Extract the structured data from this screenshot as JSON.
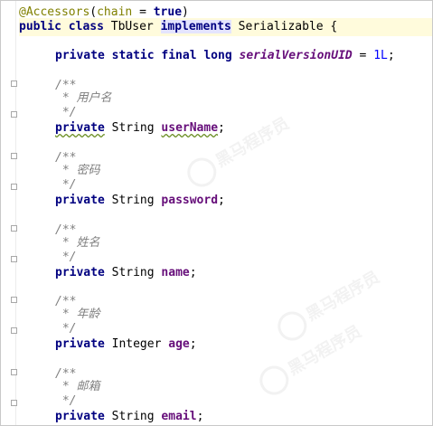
{
  "annotation": {
    "at": "@",
    "name": "Accessors",
    "open": "(",
    "param": "chain",
    "eq": " = ",
    "value": "true",
    "close": ")"
  },
  "class_decl": {
    "kw_public": "public",
    "kw_class": "class",
    "name": "TbUser",
    "kw_implements": "implements",
    "interface": "Serializable",
    "brace": "{"
  },
  "serial": {
    "modifiers": "private static final long",
    "name": "serialVersionUID",
    "eq": " = ",
    "value": "1L",
    "semi": ";"
  },
  "comment": {
    "open": "/**",
    "close": " */"
  },
  "fields": [
    {
      "comment": " * 用户名",
      "modifier": "private",
      "type": "String",
      "name": "userName",
      "semi": ";"
    },
    {
      "comment": " * 密码",
      "modifier": "private",
      "type": "String",
      "name": "password",
      "semi": ";"
    },
    {
      "comment": " * 姓名",
      "modifier": "private",
      "type": "String",
      "name": "name",
      "semi": ";"
    },
    {
      "comment": " * 年龄",
      "modifier": "private",
      "type": "Integer",
      "name": "age",
      "semi": ";"
    },
    {
      "comment": " * 邮箱",
      "modifier": "private",
      "type": "String",
      "name": "email",
      "semi": ";"
    }
  ],
  "watermark": {
    "text": "黑马程序员"
  },
  "colors": {
    "keyword": "#000080",
    "annotation": "#808000",
    "field": "#660e7a",
    "number": "#0000ff",
    "comment": "#808080",
    "caret_line": "#fffbdc"
  }
}
